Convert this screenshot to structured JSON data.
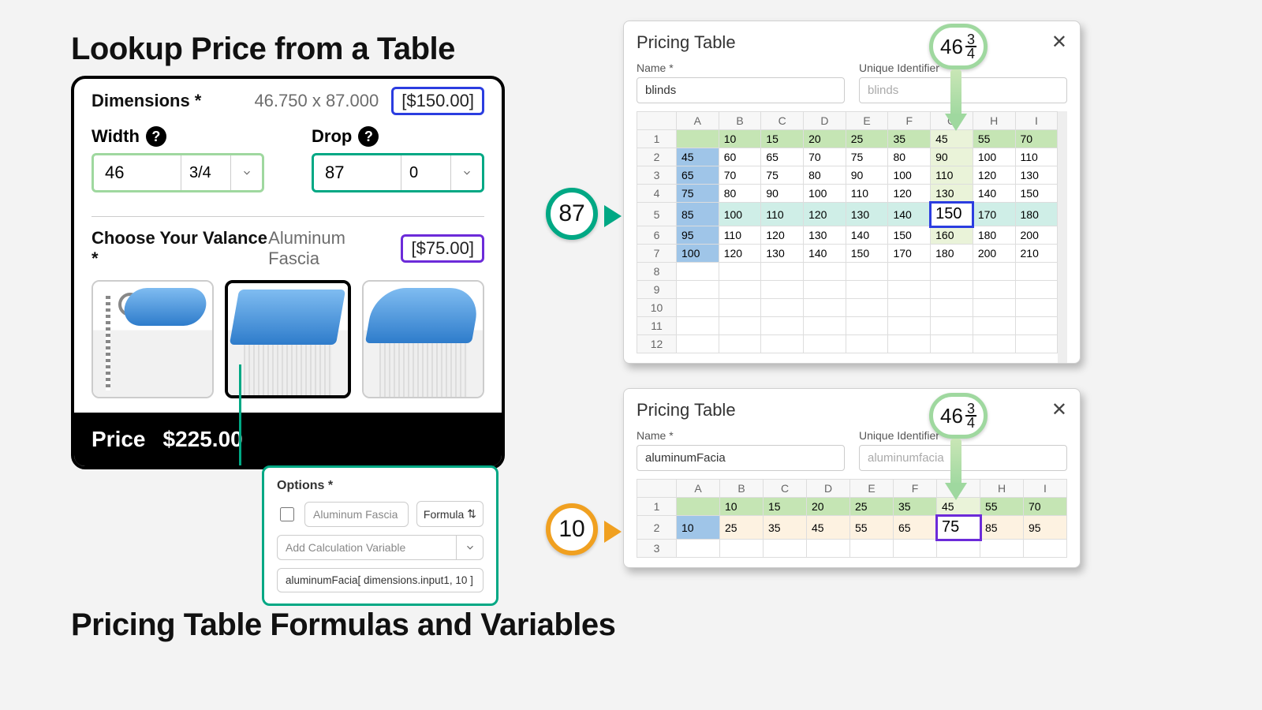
{
  "titles": {
    "top": "Lookup Price from a Table",
    "bottom": "Pricing Table Formulas and Variables"
  },
  "card": {
    "dim_label": "Dimensions *",
    "dim_value": "46.750 x 87.000",
    "dim_price": "[$150.00]",
    "width_label": "Width",
    "width_val": "46",
    "width_frac": "3/4",
    "drop_label": "Drop",
    "drop_val": "87",
    "drop_frac": "0",
    "valance_label": "Choose Your Valance *",
    "valance_sel": "Aluminum Fascia",
    "valance_price": "[$75.00]",
    "price_lbl": "Price",
    "price_val": "$225.00"
  },
  "options": {
    "title": "Options *",
    "name": "Aluminum Fascia",
    "type": "Formula",
    "add_var": "Add Calculation Variable",
    "formula": "aluminumFacia[ dimensions.input1, 10 ]"
  },
  "pt": {
    "title": "Pricing Table",
    "name_lbl": "Name *",
    "uid_lbl": "Unique Identifier",
    "cols": [
      "A",
      "B",
      "C",
      "D",
      "E",
      "F",
      "G",
      "H",
      "I"
    ],
    "p1_name": "blinds",
    "p1_uid_ph": "blinds",
    "p2_name": "aluminumFacia",
    "p2_uid_ph": "aluminumfacia"
  },
  "chart_data": [
    {
      "type": "table",
      "title": "blinds",
      "col_headers": [
        10,
        15,
        20,
        25,
        35,
        45,
        55,
        70
      ],
      "row_headers": [
        45,
        65,
        75,
        85,
        95,
        100
      ],
      "rows": [
        [
          60,
          65,
          70,
          75,
          80,
          90,
          100,
          110
        ],
        [
          70,
          75,
          80,
          90,
          100,
          110,
          120,
          130
        ],
        [
          80,
          90,
          100,
          110,
          120,
          130,
          140,
          150
        ],
        [
          100,
          110,
          120,
          130,
          140,
          150,
          170,
          180
        ],
        [
          110,
          120,
          130,
          140,
          150,
          160,
          180,
          200
        ],
        [
          120,
          130,
          140,
          150,
          170,
          180,
          200,
          210
        ]
      ],
      "lookup": {
        "width": "46 3/4",
        "drop": 87,
        "col": "G",
        "row": 5,
        "value": 150
      }
    },
    {
      "type": "table",
      "title": "aluminumFacia",
      "col_headers": [
        10,
        15,
        20,
        25,
        35,
        45,
        55,
        70
      ],
      "row_headers": [
        10
      ],
      "rows": [
        [
          25,
          35,
          45,
          55,
          65,
          75,
          85,
          95
        ]
      ],
      "lookup": {
        "width": "46 3/4",
        "drop": 10,
        "col": "G",
        "row": 2,
        "value": 75
      }
    }
  ],
  "callout": {
    "b1": "87",
    "b2": "10",
    "frac_whole": "46",
    "frac_num": "3",
    "frac_den": "4"
  }
}
